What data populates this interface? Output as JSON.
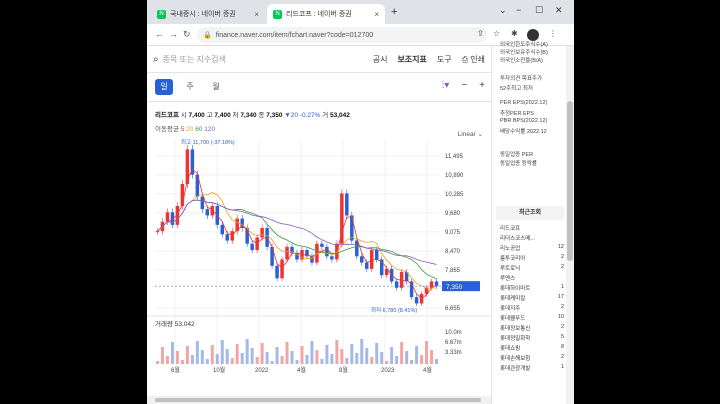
{
  "tabs": [
    {
      "label": "국내증시 : 네이버 증권",
      "close": "×"
    },
    {
      "label": "리드코프 : 네이버 증권",
      "close": "×"
    }
  ],
  "new_tab": "+",
  "window_controls": [
    "⌄",
    "−",
    "☐",
    "✕"
  ],
  "nav": {
    "back": "←",
    "forward": "→",
    "reload": "↻"
  },
  "url": "finance.naver.com/item/fchart.naver?code=012700",
  "search": {
    "placeholder": "종목 또는 지수검색"
  },
  "toplinks": [
    "공시",
    "보조지표",
    "도구",
    "인쇄"
  ],
  "periods": [
    "일",
    "주",
    "월"
  ],
  "quote": {
    "name": "리드코프",
    "open_label": "시",
    "open": "7,400",
    "high_label": "고",
    "high": "7,400",
    "low_label": "저",
    "low": "7,340",
    "close_label": "종",
    "close": "7,350",
    "change": "▼20",
    "change_pct": "-0.27%",
    "vol_label": "거",
    "volume": "53,042"
  },
  "ma": {
    "label": "이동평균",
    "values": [
      "5",
      "20",
      "60",
      "120"
    ],
    "colors": [
      "#e33",
      "#e8a020",
      "#3a9a3a",
      "#8a5ac2"
    ]
  },
  "scale_label": "Linear",
  "chart_data": {
    "type": "line",
    "title": "",
    "x_ticks": [
      "6월",
      "10월",
      "2022",
      "4월",
      "8월",
      "2023",
      "4월"
    ],
    "y_ticks": [
      "11,495",
      "10,890",
      "10,285",
      "9,680",
      "9,075",
      "8,470",
      "7,865",
      "6,655"
    ],
    "price_series": [
      9100,
      9400,
      9700,
      9300,
      9900,
      10600,
      11700,
      10900,
      10200,
      9800,
      9600,
      9900,
      9300,
      9000,
      8800,
      9100,
      9500,
      9200,
      8700,
      8500,
      8900,
      9200,
      8600,
      8000,
      7600,
      8200,
      8600,
      8400,
      8200,
      8500,
      8300,
      8100,
      8700,
      8600,
      8300,
      8200,
      8700,
      10300,
      9600,
      8800,
      8300,
      8100,
      7900,
      8500,
      8200,
      7700,
      7900,
      7500,
      7300,
      7800,
      7500,
      7000,
      6800,
      7100,
      7300,
      7500,
      7350
    ],
    "y_range": [
      6655,
      12000
    ],
    "high_annotation": "최고 11,700 (-37.18%)",
    "low_annotation": "최저 6,780 (8.41%)",
    "current_price": "7,350",
    "volume_label": "거래량",
    "volume_value": "53,042",
    "volume_ticks": [
      "10.0m",
      "6.67m",
      "3.33m"
    ]
  },
  "colors": {
    "accent": "#2a60d6",
    "up": "#e33",
    "down": "#2a60d6",
    "price_tag": "#2a60d6"
  },
  "right_panel": {
    "top_lines": [
      "외국인한도주식수(A)",
      "외국인보유주식수(B)",
      "외국인소진율(B/A)"
    ],
    "mid_lines": [
      "투자의견 목표주가",
      "52주최고 최저"
    ],
    "per_lines": [
      "PER EPS(2022.12)",
      "추정PER EPS",
      "PBR BPS(2022.12)",
      "배당수익률 2022.12"
    ],
    "sector_lines": [
      "동일업종 PER",
      "동일업종 등락률"
    ],
    "recent_header": "최근조회",
    "recent": [
      {
        "name": "리드코프",
        "n": ""
      },
      {
        "name": "리더스코스메...",
        "n": ""
      },
      {
        "name": "리노공업",
        "n": "12"
      },
      {
        "name": "룽투코리아",
        "n": "2"
      },
      {
        "name": "루트로닉",
        "n": "2"
      },
      {
        "name": "루멘스",
        "n": ""
      },
      {
        "name": "롯데하이마트",
        "n": "1"
      },
      {
        "name": "롯데케미칼",
        "n": "17"
      },
      {
        "name": "롯데지주",
        "n": "2"
      },
      {
        "name": "롯데웰푸드",
        "n": "10"
      },
      {
        "name": "롯데정보통신",
        "n": "2"
      },
      {
        "name": "롯데정밀화학",
        "n": "5"
      },
      {
        "name": "롯데쇼핑",
        "n": "8"
      },
      {
        "name": "롯데손해보험",
        "n": "2"
      },
      {
        "name": "롯데관광개발",
        "n": "1"
      }
    ]
  }
}
